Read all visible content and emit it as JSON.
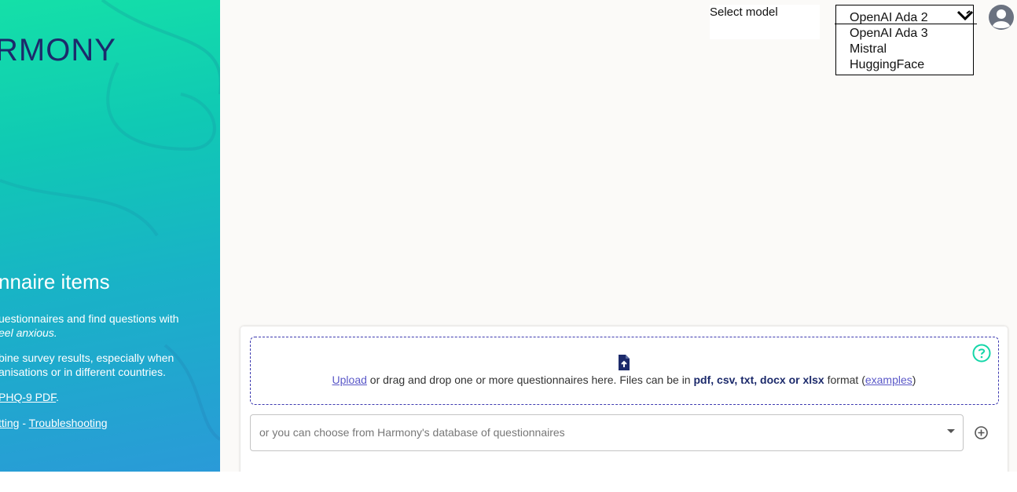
{
  "sidebar": {
    "logo_text": "RMONY",
    "heading": "nnaire items",
    "p1_line1": "uestionnaires and find questions with",
    "p1_line2": "eel anxious.",
    "p2_line1": "bine survey results, especially when",
    "p2_line2": "anisations or in different countries.",
    "p3_link": "PHQ-9 PDF",
    "p3_tail": ".",
    "p4_link1": "tting",
    "p4_sep": " - ",
    "p4_link2": "Troubleshooting"
  },
  "header": {
    "select_label": "Select model",
    "model_options": [
      "OpenAI Ada 2",
      "OpenAI Ada 3",
      "Mistral",
      "HuggingFace"
    ],
    "selected_model": "OpenAI Ada 2"
  },
  "upload": {
    "upload_link": "Upload",
    "text_before_formats": " or drag and drop one or more questionnaires here. Files can be in ",
    "formats": "pdf, csv, txt, docx or xlsx",
    "text_after_formats": " format (",
    "examples_link": "examples",
    "close_paren": ")"
  },
  "database": {
    "placeholder": "or you can choose from Harmony's database of questionnaires"
  },
  "colors": {
    "brand_navy": "#1c2a6b",
    "accent_teal": "#14e0a8",
    "link_purple": "#5a58c8"
  },
  "icons": {
    "help": "help-circle-icon",
    "upload": "file-upload-icon",
    "add": "add-circle-icon",
    "avatar": "user-avatar-icon"
  }
}
